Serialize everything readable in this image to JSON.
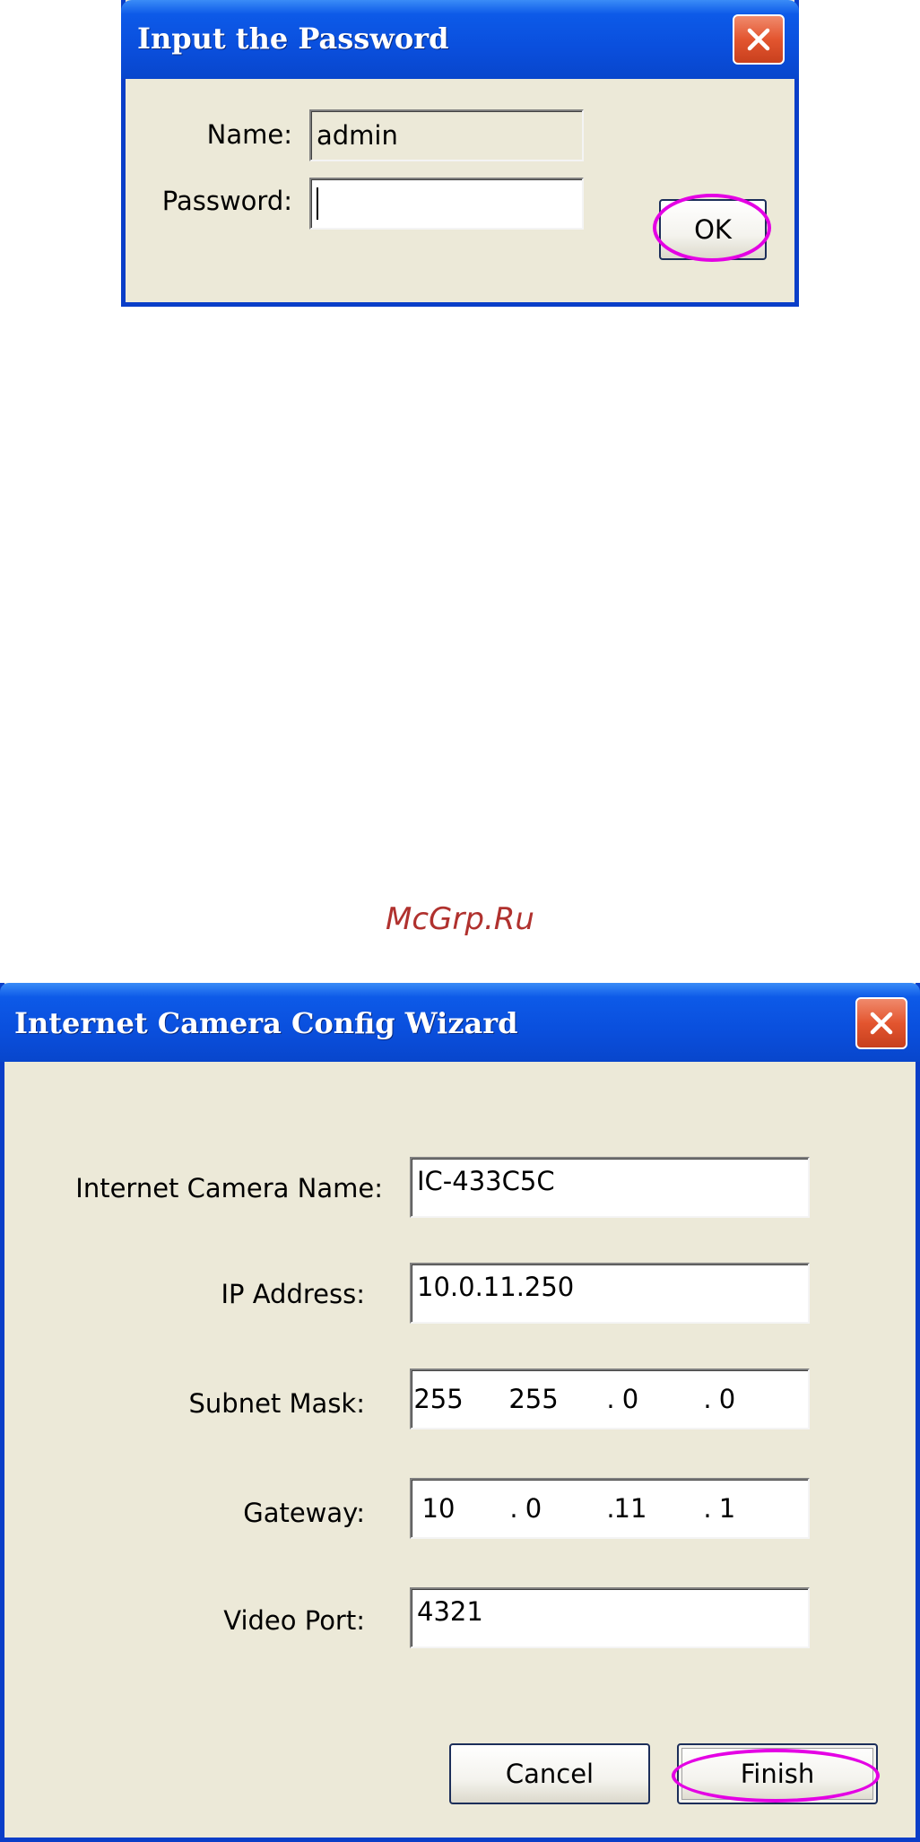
{
  "password_dialog": {
    "title": "Input the Password",
    "name_label": "Name:",
    "name_value": "admin",
    "password_label": "Password:",
    "password_value": "",
    "ok_label": "OK"
  },
  "watermark": "McGrp.Ru",
  "wizard_dialog": {
    "title": "Internet Camera Config Wizard",
    "camera_name_label": "Internet Camera Name:",
    "camera_name_value": "IC-433C5C",
    "ip_label": "IP Address:",
    "ip_value": "10.0.11.250",
    "subnet_label": "Subnet Mask:",
    "subnet_octets": [
      "255",
      "255",
      "0",
      "0"
    ],
    "gateway_label": "Gateway:",
    "gateway_octets": [
      "10",
      "0",
      "11",
      "1"
    ],
    "video_port_label": "Video Port:",
    "video_port_value": "4321",
    "cancel_label": "Cancel",
    "finish_label": "Finish"
  },
  "icons": {
    "close": "close-icon",
    "highlight": "highlight-ring"
  },
  "colors": {
    "titlebar": "#0a4fdd",
    "dialog_bg": "#ece9d8",
    "close_button": "#e3552f",
    "highlight": "#e400e4",
    "watermark": "#b0312e"
  }
}
